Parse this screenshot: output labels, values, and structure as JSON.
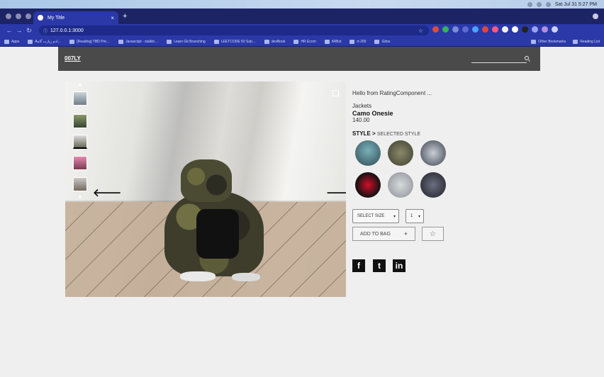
{
  "os_bar": {
    "clock": "Sat Jul 31  5:27 PM"
  },
  "browser": {
    "tab_title": "My Title",
    "tab_close": "×",
    "new_tab": "+",
    "url": "127.0.0.1:3000",
    "bookmarks": [
      "Apps",
      "Aادم زیارت گاه…",
      "[Reading] TBD Pre…",
      "Javascript - stalkin…",
      "Learn Git Branching",
      "LEETCODE 50 Sub…",
      "devBook",
      "HR Ecom",
      "hRBst",
      "rt-200",
      "Gdso"
    ],
    "bookmarks_right": [
      "Other Bookmarks",
      "Reading List"
    ]
  },
  "site": {
    "logo": "007LY"
  },
  "product": {
    "rating_text": "Hello from RatingComponent ...",
    "category": "Jackets",
    "name": "Camo Onesie",
    "price": "140.00",
    "style_label": "STYLE >",
    "selected_style": "SELECTED STYLE",
    "size_select": "SELECT SIZE",
    "qty_select": "1",
    "add_to_bag": "ADD TO BAG",
    "add_plus": "+",
    "favorite": "☆"
  },
  "gallery": {
    "arrow_left": "🡐",
    "arrow_right": "🡒",
    "thumb_up": "▲",
    "thumb_down": "▼"
  },
  "social": {
    "facebook": "f",
    "twitter": "t",
    "linkedin": "in"
  },
  "colors": {
    "header_bg": "#4a4a4a",
    "tab_bar": "#1c2466",
    "toolbar": "#2a38a8"
  }
}
